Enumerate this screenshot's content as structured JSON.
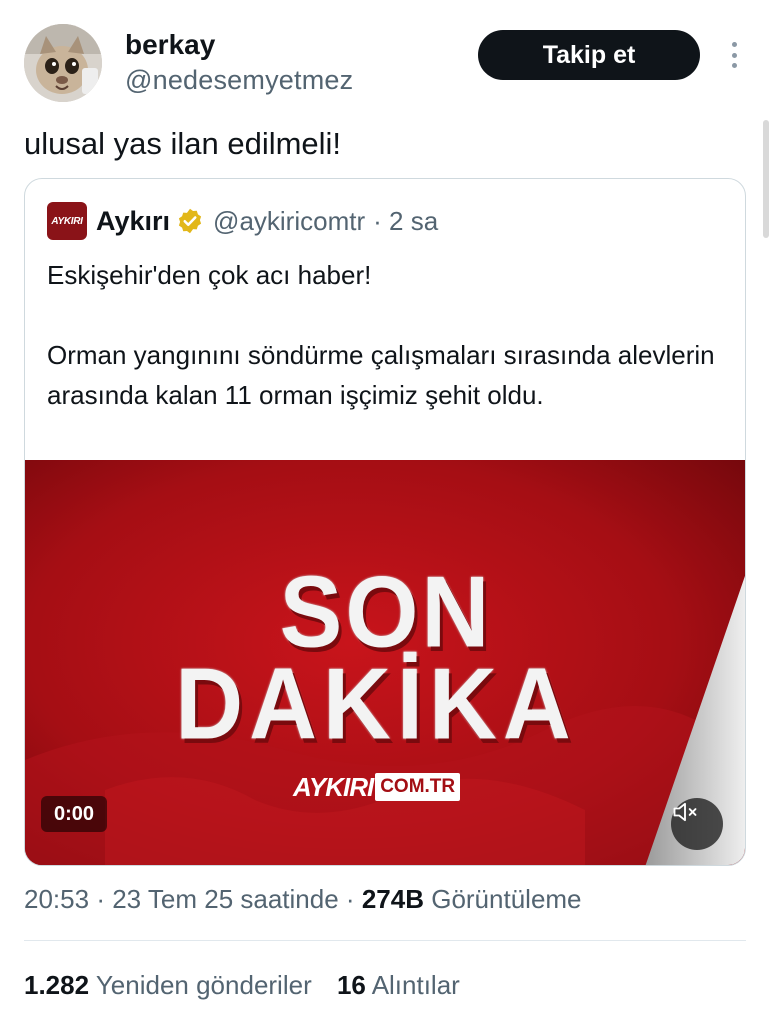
{
  "user": {
    "display_name": "berkay",
    "handle": "@nedesemyetmez",
    "avatar_icon": "cat-photo-avatar"
  },
  "actions": {
    "follow_label": "Takip et",
    "more_icon": "vertical-ellipsis-icon"
  },
  "tweet": {
    "text": "ulusal yas ilan edilmeli!"
  },
  "quoted": {
    "logo_text": "AYKIRI",
    "name": "Aykırı",
    "verified_icon": "gold-verified-badge-icon",
    "handle": "@aykiricomtr",
    "time": "· 2 sa",
    "paragraphs": [
      "Eskişehir'den çok acı haber!",
      "Orman yangınını söndürme çalışmaları sırasında alevlerin arasında kalan 11 orman işçimiz şehit oldu."
    ],
    "media": {
      "line1": "SON",
      "line2": "DAKİKA",
      "brand_left": "AYKIRI",
      "brand_right": "COM.TR",
      "timer": "0:00",
      "mute_icon": "speaker-muted-icon",
      "bg_color": "#9d0d12"
    }
  },
  "meta": {
    "time": "20:53",
    "sep1": "·",
    "date": "23 Tem 25 saatinde",
    "sep2": "·",
    "views": "274B",
    "views_label": "Görüntüleme"
  },
  "stats": {
    "reposts": "1.282",
    "reposts_label": "Yeniden gönderiler",
    "quotes": "16",
    "quotes_label": "Alıntılar"
  },
  "colors": {
    "text": "#0f1419",
    "secondary": "#536471",
    "border": "#cfd9de",
    "verified_gold": "#e2b719"
  }
}
